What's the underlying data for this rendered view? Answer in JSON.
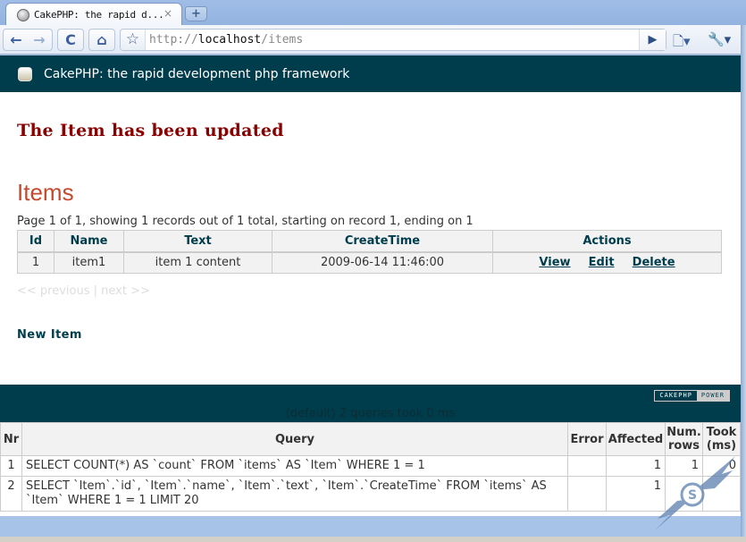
{
  "browser": {
    "tab_title": "CakePHP: the rapid d...",
    "tab_close": "×",
    "new_tab": "+",
    "url_scheme": "http://",
    "url_host": "localhost",
    "url_path": "/items",
    "icons": {
      "back": "←",
      "forward": "→",
      "reload": "C",
      "home": "⌂",
      "bookmark": "☆",
      "go": "▶",
      "page_menu": "🗋▾",
      "tools_menu": "🔧▾"
    }
  },
  "app": {
    "header_title": "CakePHP: the rapid development php framework",
    "flash_message": "The Item has been updated",
    "page_title": "Items",
    "paging_info": "Page 1 of 1, showing 1 records out of 1 total, starting on record 1, ending on 1",
    "table": {
      "headers": [
        "Id",
        "Name",
        "Text",
        "CreateTime",
        "Actions"
      ],
      "rows": [
        {
          "id": "1",
          "name": "item1",
          "text": "item 1 content",
          "create_time": "2009-06-14 11:46:00",
          "actions": [
            "View",
            "Edit",
            "Delete"
          ]
        }
      ]
    },
    "pager": {
      "previous": "<< previous",
      "separator": "|",
      "next": "next >>"
    },
    "new_item_link": "New Item",
    "powered_badge": {
      "left": "CAKEPHP",
      "right": "POWER"
    }
  },
  "sql_log": {
    "caption": "(default) 2 queries took 0 ms",
    "headers": [
      "Nr",
      "Query",
      "Error",
      "Affected",
      "Num. rows",
      "Took (ms)"
    ],
    "rows": [
      {
        "nr": "1",
        "query": "SELECT COUNT(*) AS `count` FROM `items` AS `Item` WHERE 1 = 1",
        "error": "",
        "affected": "1",
        "num_rows": "1",
        "took": "0"
      },
      {
        "nr": "2",
        "query": "SELECT `Item`.`id`, `Item`.`name`, `Item`.`text`, `Item`.`CreateTime` FROM `items` AS `Item` WHERE 1 = 1 LIMIT 20",
        "error": "",
        "affected": "1",
        "num_rows": "",
        "took": ""
      }
    ]
  },
  "colors": {
    "header_bg": "#003d4c",
    "flash": "#8a0000",
    "title": "#c6492d",
    "link": "#003d4c"
  }
}
